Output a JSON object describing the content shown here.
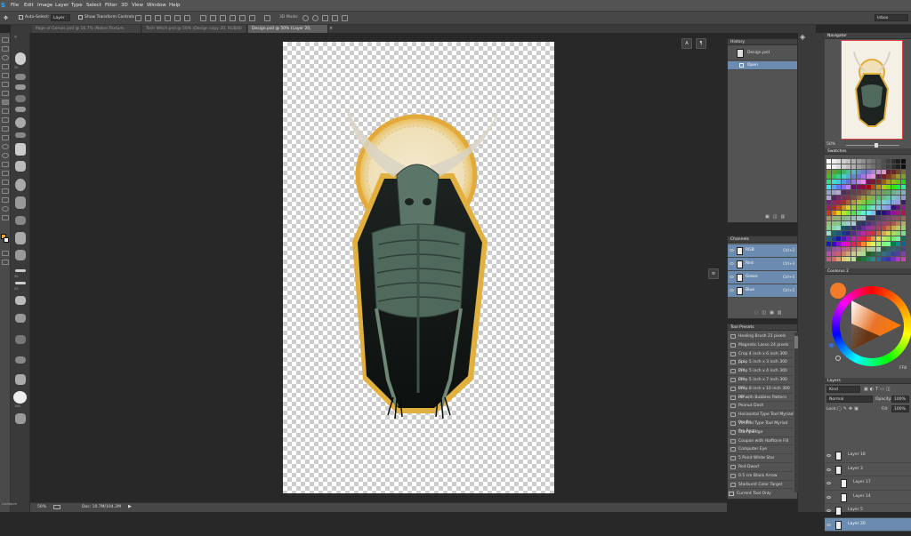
{
  "menubar": {
    "items": [
      "File",
      "Edit",
      "Image",
      "Layer",
      "Type",
      "Select",
      "Filter",
      "3D",
      "View",
      "Window",
      "Help"
    ],
    "workspace": "Inbox"
  },
  "options": {
    "auto_select_label": "Auto-Select:",
    "auto_select_value": "Layer",
    "transform_label": "Show Transform Controls",
    "mode_3d": "3D Mode:"
  },
  "tabs": [
    {
      "label": "Page of Genuis.psd @ 16.7% (Notse Texture, RGB/8)",
      "active": false
    },
    {
      "label": "Tech Witch.psd @ 50% (Design copy 20, RGB/8) *",
      "active": false
    },
    {
      "label": "Design.psd @ 50% (Layer 20, RGB/8)",
      "active": true
    }
  ],
  "brushes": [
    "",
    "",
    "30",
    "",
    "",
    "",
    "",
    "",
    "",
    "",
    "",
    "",
    "",
    "",
    "",
    "",
    "",
    "30",
    "25",
    "",
    "",
    "",
    "",
    "",
    "",
    "",
    "100",
    "",
    "",
    "",
    "",
    ""
  ],
  "status": {
    "zoom": "50%",
    "doc": "Doc: 10.7M/104.2M",
    "configure": "Configure"
  },
  "history": {
    "title": "History",
    "doc_name": "Design.psd",
    "items": [
      {
        "label": "Open",
        "selected": true
      }
    ]
  },
  "channels": {
    "title": "Channels",
    "rows": [
      {
        "name": "RGB",
        "shortcut": "Ctrl+2"
      },
      {
        "name": "Red",
        "shortcut": "Ctrl+3"
      },
      {
        "name": "Green",
        "shortcut": "Ctrl+4"
      },
      {
        "name": "Blue",
        "shortcut": "Ctrl+5"
      }
    ]
  },
  "tool_presets": {
    "title": "Tool Presets",
    "items": [
      "Healing Brush 21 pixels",
      "Magnetic Lasso 24 pixels",
      "Crop 4 inch x 6 inch 300 ppi",
      "Crop 5 inch x 3 inch 300 ppi",
      "Crop 5 inch x 4 inch 300 ppi",
      "Crop 5 inch x 7 inch 300 ppi",
      "Crop 8 inch x 10 inch 300 ppi",
      "Fill with Bubbles Pattern",
      "Peanut Dash",
      "Horizontal Type Tool Myriad Pro Re",
      "Vertical Type Tool Myriad Pro Regu",
      "Stamp Edge",
      "Coupon with Halftone Fill",
      "Computer Eye",
      "5 Point White Star",
      "Red Dwarf",
      "0.5 cm Black Arrow",
      "Starburst Color Target"
    ],
    "current_only": "Current Tool Only"
  },
  "navigator": {
    "title": "Navigator",
    "zoom": "50%"
  },
  "swatches": {
    "title": "Swatches"
  },
  "coolorus": {
    "title": "Coolorus 2",
    "hex": "FF8"
  },
  "layers": {
    "title": "Layers",
    "kind": "Kind",
    "blend": "Normal",
    "opacity_label": "Opacity:",
    "opacity": "100%",
    "lock_label": "Lock:",
    "fill_label": "Fill:",
    "fill": "100%",
    "items": [
      {
        "name": "Layer 18",
        "indent": false,
        "selected": false
      },
      {
        "name": "Layer 3",
        "indent": false,
        "selected": false
      },
      {
        "name": "Layer 17",
        "indent": true,
        "selected": false
      },
      {
        "name": "Layer 14",
        "indent": true,
        "selected": false
      },
      {
        "name": "Layer 5",
        "indent": false,
        "selected": false
      },
      {
        "name": "Layer 20",
        "indent": false,
        "selected": true
      }
    ]
  },
  "colors": {
    "accent": "#6b8bb0",
    "foreground": "#f5a623",
    "panel": "#535353"
  }
}
